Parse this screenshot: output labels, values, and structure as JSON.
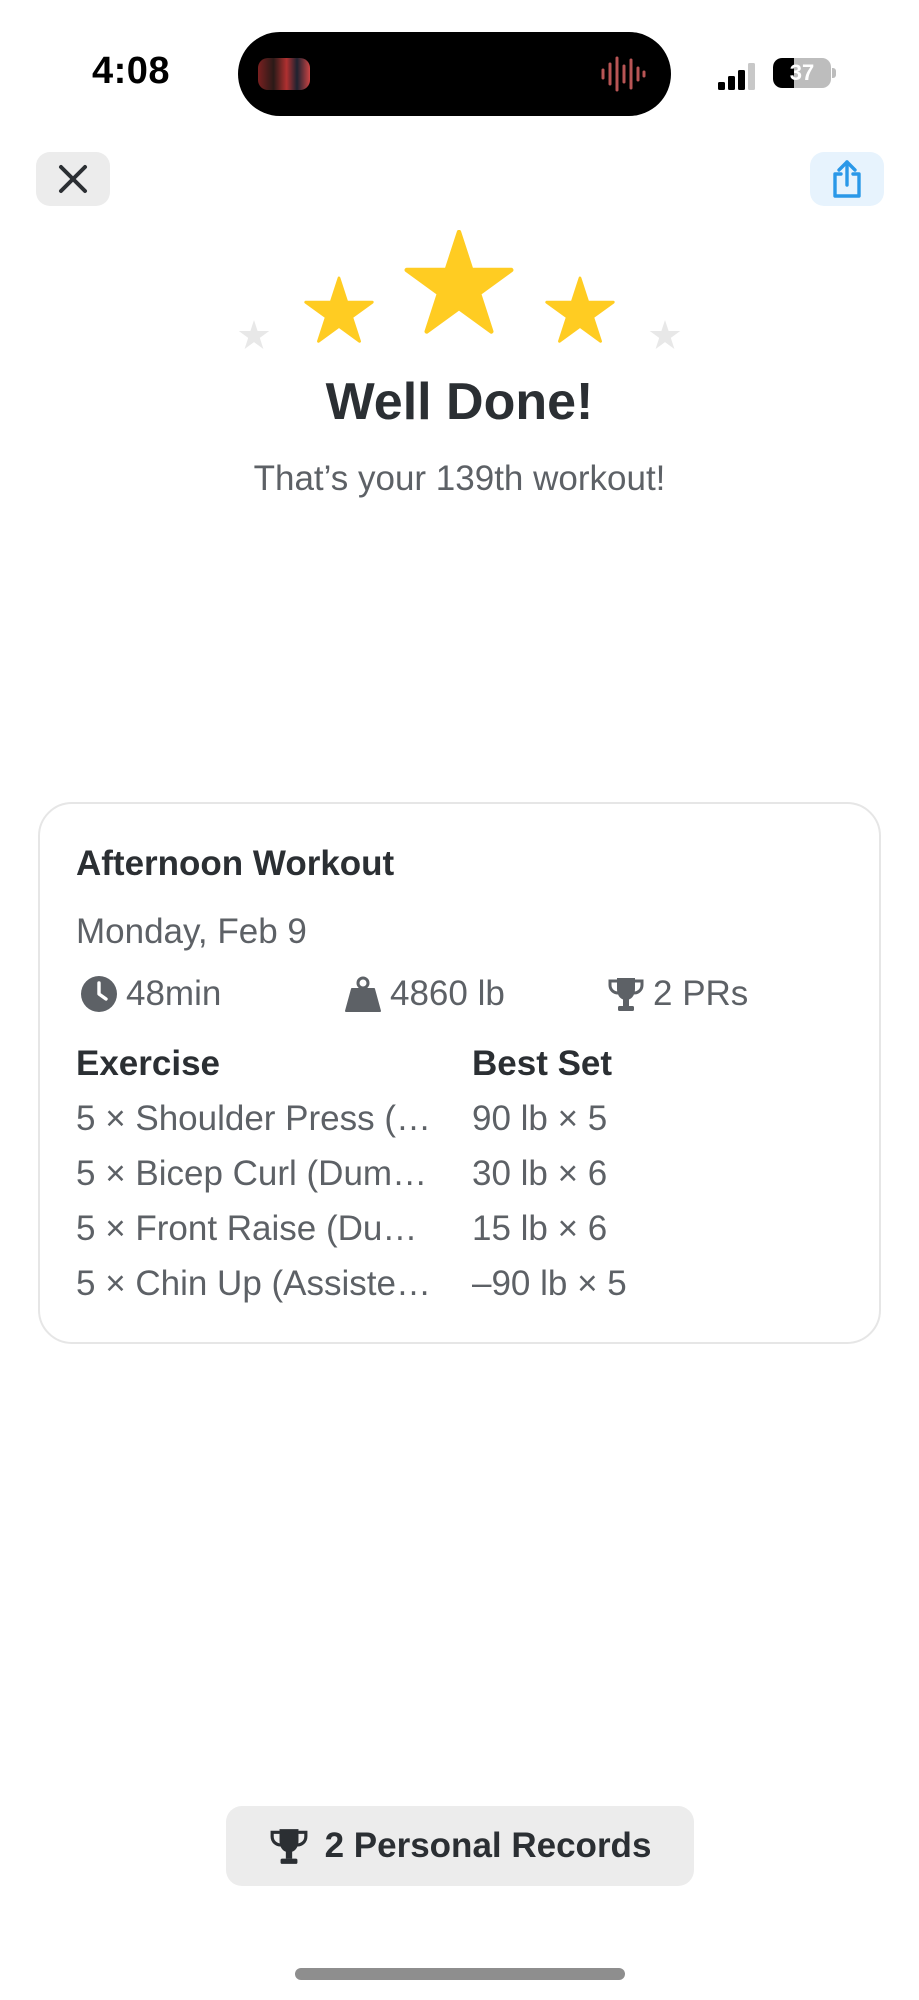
{
  "status_bar": {
    "time": "4:08",
    "battery_label": "37",
    "battery_level": 0.37
  },
  "header": {
    "close_icon": "close-icon",
    "share_icon": "share-icon",
    "accent_color": "#2a98e8"
  },
  "celebration": {
    "title": "Well Done!",
    "subtitle": "That’s your 139th workout!",
    "star_color": "#ffcc22",
    "filled_stars": 3
  },
  "workout_card": {
    "title": "Afternoon Workout",
    "date": "Monday, Feb 9",
    "stats": {
      "duration": "48min",
      "volume": "4860 lb",
      "prs": "2 PRs"
    },
    "headers": {
      "exercise": "Exercise",
      "best_set": "Best Set"
    },
    "rows": [
      {
        "exercise": "5 × Shoulder Press (…",
        "best_set": "90 lb × 5"
      },
      {
        "exercise": "5 × Bicep Curl (Dum…",
        "best_set": "30 lb × 6"
      },
      {
        "exercise": "5 × Front Raise (Du…",
        "best_set": "15 lb × 6"
      },
      {
        "exercise": "5 × Chin Up (Assiste…",
        "best_set": "–90 lb × 5"
      }
    ]
  },
  "footer": {
    "personal_records_label": "2 Personal Records"
  }
}
